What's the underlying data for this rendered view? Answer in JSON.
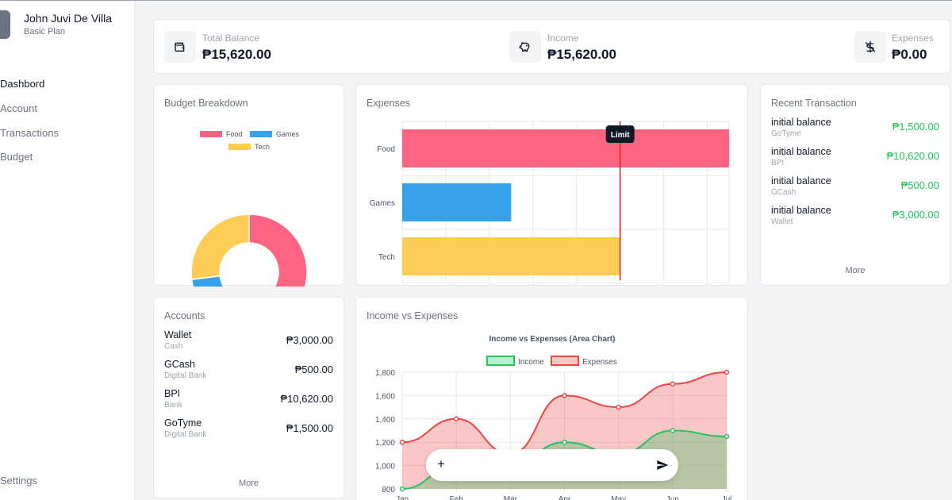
{
  "user": {
    "name": "John Juvi De Villa",
    "plan": "Basic Plan"
  },
  "nav": {
    "items": [
      "Dashbord",
      "Account",
      "Transactions",
      "Budget"
    ],
    "settings": "Settings",
    "active": "Dashbord"
  },
  "stats": {
    "total_balance": {
      "label": "Total Balance",
      "value": "₱15,620.00",
      "icon": "wallet-icon"
    },
    "income": {
      "label": "Income",
      "value": "₱15,620.00",
      "icon": "piggy-bank-icon"
    },
    "expenses": {
      "label": "Expenses",
      "value": "₱0.00",
      "icon": "dollar-icon"
    }
  },
  "budget_breakdown": {
    "title": "Budget Breakdown",
    "legend": [
      "Food",
      "Games",
      "Tech"
    ]
  },
  "expenses_card": {
    "title": "Expenses",
    "limit_label": "Limit"
  },
  "recent_transactions": {
    "title": "Recent Transaction",
    "items": [
      {
        "name": "initial balance",
        "source": "GoTyme",
        "amount": "₱1,500.00"
      },
      {
        "name": "initial balance",
        "source": "BPI",
        "amount": "₱10,620.00"
      },
      {
        "name": "initial balance",
        "source": "GCash",
        "amount": "₱500.00"
      },
      {
        "name": "initial balance",
        "source": "Wallet",
        "amount": "₱3,000.00"
      }
    ],
    "more": "More"
  },
  "accounts": {
    "title": "Accounts",
    "items": [
      {
        "name": "Wallet",
        "type": "Cash",
        "amount": "₱3,000.00"
      },
      {
        "name": "GCash",
        "type": "Digital Bank",
        "amount": "₱500.00"
      },
      {
        "name": "BPI",
        "type": "Bank",
        "amount": "₱10,620.00"
      },
      {
        "name": "GoTyme",
        "type": "Digital Bank",
        "amount": "₱1,500.00"
      }
    ],
    "more": "More"
  },
  "income_vs_expenses_card": {
    "title": "Income vs Expenses"
  },
  "colors": {
    "food": "#ff6384",
    "games": "#36a2eb",
    "tech": "#ffcd56",
    "income": "#22c55e",
    "expenses": "#ef4444",
    "accent_green": "#22c55e"
  },
  "chart_data": [
    {
      "type": "pie",
      "variant": "doughnut",
      "categories": [
        "Food",
        "Games",
        "Tech"
      ],
      "values": [
        62,
        11,
        27
      ],
      "legend": "top"
    },
    {
      "type": "bar",
      "orientation": "horizontal",
      "categories": [
        "Food",
        "Games",
        "Tech"
      ],
      "values": [
        150,
        50,
        100
      ],
      "xlim": [
        0,
        150
      ],
      "xticks": [
        "0",
        "20",
        "40",
        "60",
        "80",
        "100",
        "120",
        "140",
        "150"
      ],
      "annotation": {
        "label": "Limit",
        "x": 100
      },
      "grid": true
    },
    {
      "type": "area",
      "title": "Income vs Expenses (Area Chart)",
      "x": [
        "Jan",
        "Feb",
        "Mar",
        "Apr",
        "May",
        "Jun",
        "Jul"
      ],
      "series": [
        {
          "name": "Income",
          "values": [
            800,
            1000,
            1000,
            1200,
            1100,
            1300,
            1250
          ]
        },
        {
          "name": "Expenses",
          "values": [
            1200,
            1400,
            1100,
            1600,
            1500,
            1700,
            1800
          ]
        }
      ],
      "ylim": [
        800,
        1800
      ],
      "yticks": [
        "800",
        "1,000",
        "1,200",
        "1,400",
        "1,600",
        "1,800"
      ],
      "legend": "top",
      "grid": true
    }
  ]
}
